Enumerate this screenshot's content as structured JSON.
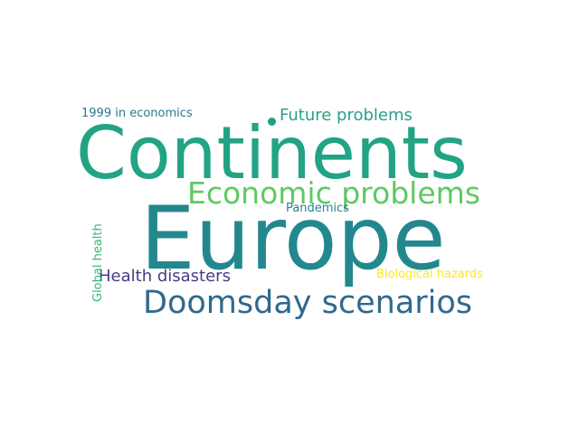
{
  "words": {
    "continents": {
      "text": "Continents",
      "color": "#22a384"
    },
    "europe": {
      "text": "Europe",
      "color": "#23888e"
    },
    "economic_problems": {
      "text": "Economic problems",
      "color": "#5ec962"
    },
    "doomsday_scenarios": {
      "text": "Doomsday scenarios",
      "color": "#30698e"
    },
    "future_problems": {
      "text": "Future problems",
      "color": "#2aa087"
    },
    "health_disasters": {
      "text": "Health disasters",
      "color": "#433e85"
    },
    "economics_1999": {
      "text": "1999 in economics",
      "color": "#29798e"
    },
    "pandemics": {
      "text": "Pandemics",
      "color": "#26838f"
    },
    "biological_hazards": {
      "text": "Biological hazards",
      "color": "#fde725"
    },
    "global_health": {
      "text": "Global health",
      "color": "#35b779"
    }
  },
  "dot_color": "#1f9e89"
}
